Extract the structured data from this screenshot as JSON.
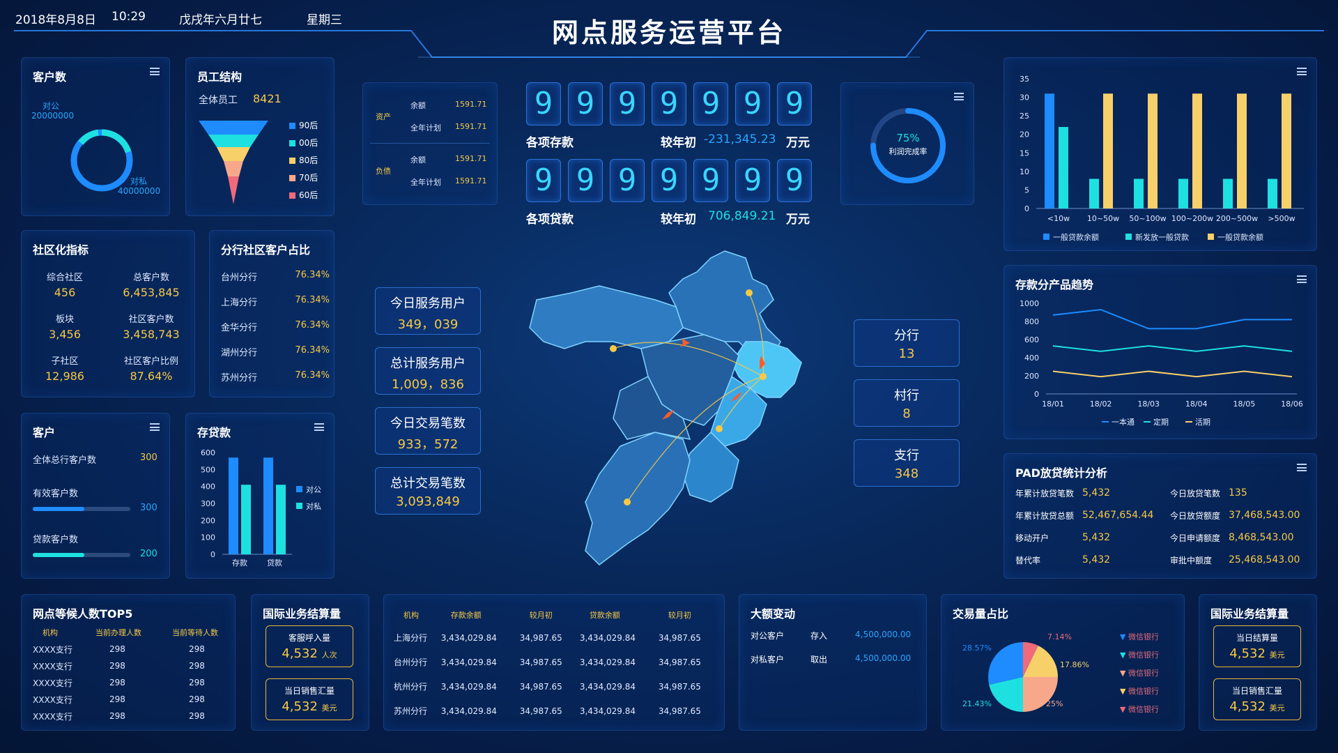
{
  "header": {
    "date": "2018年8月8日",
    "time": "10:29",
    "lunar": "戊戌年六月廿七",
    "weekday": "星期三",
    "title": "网点服务运营平台"
  },
  "customers": {
    "title": "客户数",
    "public_label": "对公",
    "public_value": "20000000",
    "private_label": "对私",
    "private_value": "40000000"
  },
  "staff": {
    "title": "员工结构",
    "total_label": "全体员工",
    "total_value": "8421",
    "legend": [
      {
        "label": "90后",
        "color": "#1e8cff"
      },
      {
        "label": "00后",
        "color": "#1fe0e0"
      },
      {
        "label": "80后",
        "color": "#f7d06a"
      },
      {
        "label": "70后",
        "color": "#f8a88a"
      },
      {
        "label": "60后",
        "color": "#f06a7a"
      }
    ]
  },
  "assets": {
    "asset_label": "资产",
    "debt_label": "负债",
    "balance_label": "余额",
    "plan_label": "全年计划",
    "a_balance": "1591.71",
    "a_plan": "1591.71",
    "d_balance": "1591.71",
    "d_plan": "1591.71"
  },
  "deposits": {
    "digits": [
      "9",
      "9",
      "9",
      "9",
      "9",
      "9",
      "9"
    ],
    "label": "各项存款",
    "cmp_label": "较年初",
    "cmp_value": "-231,345.23",
    "unit": "万元"
  },
  "loans": {
    "digits": [
      "9",
      "9",
      "9",
      "9",
      "9",
      "9",
      "9"
    ],
    "label": "各项贷款",
    "cmp_label": "较年初",
    "cmp_value": "706,849.21",
    "unit": "万元"
  },
  "profit": {
    "percent": "75%",
    "label": "利润完成率",
    "fraction": 0.75
  },
  "community": {
    "title": "社区化指标",
    "items": [
      {
        "label": "综合社区",
        "value": "456"
      },
      {
        "label": "总客户数",
        "value": "6,453,845"
      },
      {
        "label": "板块",
        "value": "3,456"
      },
      {
        "label": "社区客户数",
        "value": "3,458,743"
      },
      {
        "label": "子社区",
        "value": "12,986"
      },
      {
        "label": "社区客户比例",
        "value": "87.64%"
      }
    ]
  },
  "branch_ratio": {
    "title": "分行社区客户占比",
    "items": [
      {
        "label": "台州分行",
        "value": "76.34%"
      },
      {
        "label": "上海分行",
        "value": "76.34%"
      },
      {
        "label": "金华分行",
        "value": "76.34%"
      },
      {
        "label": "湖州分行",
        "value": "76.34%"
      },
      {
        "label": "苏州分行",
        "value": "76.34%"
      }
    ]
  },
  "client": {
    "title": "客户",
    "items": [
      {
        "label": "全体总行客户数",
        "value": "300"
      },
      {
        "label": "有效客户数",
        "value": "300",
        "fill": 0.53
      },
      {
        "label": "贷款客户数",
        "value": "200",
        "fill": 0.53
      }
    ]
  },
  "deposit_loan": {
    "title": "存贷款",
    "legend": [
      "对公",
      "对私"
    ]
  },
  "services": [
    {
      "label": "今日服务用户",
      "value": "349，039"
    },
    {
      "label": "总计服务用户",
      "value": "1,009，836"
    },
    {
      "label": "今日交易笔数",
      "value": "933，572"
    },
    {
      "label": "总计交易笔数",
      "value": "3,093,849"
    }
  ],
  "org": [
    {
      "label": "分行",
      "value": "13"
    },
    {
      "label": "村行",
      "value": "8"
    },
    {
      "label": "支行",
      "value": "348"
    }
  ],
  "trend": {
    "title": "存款分产品趋势",
    "legend": [
      "一本通",
      "定期",
      "活期"
    ]
  },
  "pad": {
    "title": "PAD放贷统计分析",
    "items": [
      {
        "label": "年累计放贷笔数",
        "value": "5,432"
      },
      {
        "label": "今日放贷笔数",
        "value": "135"
      },
      {
        "label": "年累计放贷总额",
        "value": "52,467,654.44"
      },
      {
        "label": "今日放贷额度",
        "value": "37,468,543.00"
      },
      {
        "label": "移动开户",
        "value": "5,432"
      },
      {
        "label": "今日申请额度",
        "value": "8,468,543.00"
      },
      {
        "label": "替代率",
        "value": "5,432"
      },
      {
        "label": "审批中额度",
        "value": "25,468,543.00"
      }
    ]
  },
  "waiting": {
    "title": "网点等候人数TOP5",
    "headers": [
      "机构",
      "当前办理人数",
      "当前等待人数"
    ],
    "rows": [
      [
        "XXXX支行",
        "298",
        "298"
      ],
      [
        "XXXX支行",
        "298",
        "298"
      ],
      [
        "XXXX支行",
        "298",
        "298"
      ],
      [
        "XXXX支行",
        "298",
        "298"
      ],
      [
        "XXXX支行",
        "298",
        "298"
      ]
    ]
  },
  "intl1": {
    "title": "国际业务结算量",
    "boxes": [
      {
        "label": "客服呼入量",
        "value": "4,532",
        "unit": "人次"
      },
      {
        "label": "当日销售汇量",
        "value": "4,532",
        "unit": "美元"
      }
    ]
  },
  "branches_table": {
    "headers": [
      "机构",
      "存款余额",
      "较月初",
      "贷款余额",
      "较月初"
    ],
    "rows": [
      [
        "上海分行",
        "3,434,029.84",
        "34,987.65",
        "3,434,029.84",
        "34,987.65"
      ],
      [
        "台州分行",
        "3,434,029.84",
        "34,987.65",
        "3,434,029.84",
        "34,987.65"
      ],
      [
        "杭州分行",
        "3,434,029.84",
        "34,987.65",
        "3,434,029.84",
        "34,987.65"
      ],
      [
        "苏州分行",
        "3,434,029.84",
        "34,987.65",
        "3,434,029.84",
        "34,987.65"
      ]
    ]
  },
  "large": {
    "title": "大额变动",
    "rows": [
      {
        "who": "对公客户",
        "act": "存入",
        "amt": "4,500,000.00"
      },
      {
        "who": "对私客户",
        "act": "取出",
        "amt": "4,500,000.00"
      }
    ]
  },
  "txn_share": {
    "title": "交易量占比",
    "legend": [
      {
        "label": "微信银行",
        "color": "#1e8cff"
      },
      {
        "label": "微信银行",
        "color": "#1fe0e0"
      },
      {
        "label": "微信银行",
        "color": "#f8a88a"
      },
      {
        "label": "微信银行",
        "color": "#f7d06a"
      },
      {
        "label": "微信银行",
        "color": "#f06a7a"
      }
    ]
  },
  "intl2": {
    "title": "国际业务结算量",
    "boxes": [
      {
        "label": "当日结算量",
        "value": "4,532",
        "unit": "美元"
      },
      {
        "label": "当日销售汇量",
        "value": "4,532",
        "unit": "美元"
      }
    ]
  },
  "colors": {
    "blue": "#1e8cff",
    "cyan": "#1fe0e0",
    "yellow": "#f7d06a",
    "salmon": "#f8a88a",
    "pink": "#f06a7a"
  },
  "chart_data": [
    {
      "type": "bar",
      "title": "",
      "categories": [
        "<10w",
        "10~50w",
        "50~100w",
        "100~200w",
        "200~500w",
        ">500w"
      ],
      "ylim": [
        0,
        35
      ],
      "yticks": [
        0,
        5,
        10,
        15,
        20,
        25,
        30,
        35
      ],
      "series": [
        {
          "name": "一般贷款余额",
          "color": "#1e8cff",
          "values": [
            31,
            0,
            0,
            0,
            0,
            0
          ]
        },
        {
          "name": "新发放一般贷款",
          "color": "#1fe0e0",
          "values": [
            22,
            8,
            8,
            8,
            8,
            8
          ]
        },
        {
          "name": "一般贷款余额",
          "color": "#f7d06a",
          "values": [
            0,
            31,
            31,
            31,
            31,
            31
          ]
        }
      ]
    },
    {
      "type": "line",
      "title": "存款分产品趋势",
      "x": [
        "18/01",
        "18/02",
        "18/03",
        "18/04",
        "18/05",
        "18/06"
      ],
      "ylim": [
        0,
        1000
      ],
      "yticks": [
        0,
        200,
        400,
        600,
        800,
        1000
      ],
      "series": [
        {
          "name": "一本通",
          "color": "#1e8cff",
          "values": [
            870,
            930,
            720,
            720,
            820,
            820
          ]
        },
        {
          "name": "定期",
          "color": "#1fe0e0",
          "values": [
            530,
            470,
            530,
            470,
            530,
            470
          ]
        },
        {
          "name": "活期",
          "color": "#f7d06a",
          "values": [
            250,
            190,
            250,
            190,
            250,
            190
          ]
        }
      ]
    },
    {
      "type": "bar",
      "title": "存贷款",
      "categories": [
        "存款",
        "贷款"
      ],
      "ylim": [
        0,
        600
      ],
      "yticks": [
        0,
        100,
        200,
        300,
        400,
        500,
        600
      ],
      "series": [
        {
          "name": "对公",
          "color": "#1e8cff",
          "values": [
            570,
            570
          ]
        },
        {
          "name": "对私",
          "color": "#1fe0e0",
          "values": [
            410,
            410
          ]
        }
      ]
    },
    {
      "type": "pie",
      "title": "交易量占比",
      "slices": [
        {
          "label": "7.14%",
          "value": 7.14,
          "color": "#f06a7a"
        },
        {
          "label": "17.86%",
          "value": 17.86,
          "color": "#f7d06a"
        },
        {
          "label": "25%",
          "value": 25,
          "color": "#f8a88a"
        },
        {
          "label": "21.43%",
          "value": 21.43,
          "color": "#1fe0e0"
        },
        {
          "label": "28.57%",
          "value": 28.57,
          "color": "#1e8cff"
        }
      ]
    }
  ]
}
